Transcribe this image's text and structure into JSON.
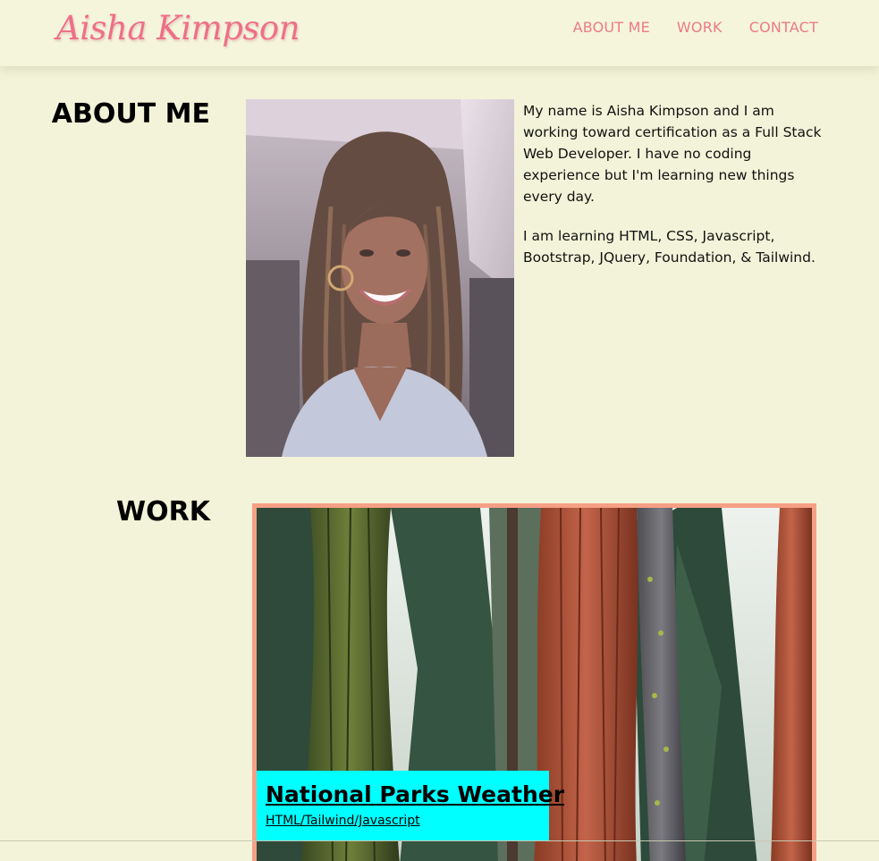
{
  "header": {
    "brand": "Aisha Kimpson",
    "nav": [
      "ABOUT ME",
      "WORK",
      "CONTACT"
    ]
  },
  "about": {
    "title": "ABOUT ME",
    "paragraphs": [
      "My name is Aisha Kimpson and I am working toward certification as a Full Stack Web Developer. I have no coding experience but I'm learning new things every day.",
      "I am learning HTML, CSS, Javascript, Bootstrap, JQuery, Foundation, & Tailwind."
    ]
  },
  "work": {
    "title": "WORK",
    "projects": [
      {
        "title": "National Parks Weather",
        "tech": "HTML/Tailwind/Javascript"
      }
    ]
  },
  "colors": {
    "background": "#f3f3d9",
    "brand": "#ee7088",
    "nav": "#ee7a86",
    "card_border": "#f5a085",
    "label_bg": "#00ffff"
  }
}
